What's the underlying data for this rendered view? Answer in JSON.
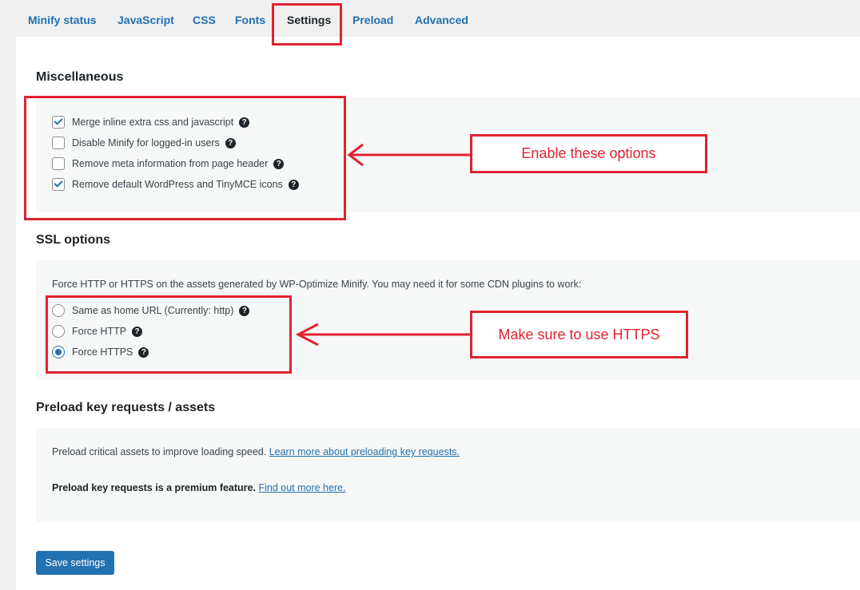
{
  "tabs": [
    {
      "label": "Minify status"
    },
    {
      "label": "JavaScript"
    },
    {
      "label": "CSS"
    },
    {
      "label": "Fonts"
    },
    {
      "label": "Settings"
    },
    {
      "label": "Preload"
    },
    {
      "label": "Advanced"
    }
  ],
  "active_tab": "Settings",
  "miscellaneous": {
    "title": "Miscellaneous",
    "options": [
      {
        "label": "Merge inline extra css and javascript",
        "checked": true
      },
      {
        "label": "Disable Minify for logged-in users",
        "checked": false
      },
      {
        "label": "Remove meta information from page header",
        "checked": false
      },
      {
        "label": "Remove default WordPress and TinyMCE icons",
        "checked": true
      }
    ]
  },
  "ssl": {
    "title": "SSL options",
    "description": "Force HTTP or HTTPS on the assets generated by WP-Optimize Minify. You may need it for some CDN plugins to work:",
    "options": [
      {
        "label": "Same as home URL (Currently: http)",
        "selected": false
      },
      {
        "label": "Force HTTP",
        "selected": false
      },
      {
        "label": "Force HTTPS",
        "selected": true
      }
    ]
  },
  "preload": {
    "title": "Preload key requests / assets",
    "description": "Preload critical assets to improve loading speed.",
    "learn_link": "Learn more about preloading key requests.",
    "premium_text": "Preload key requests is a premium feature.",
    "premium_link": "Find out more here."
  },
  "annotations": {
    "callout_1": "Enable these options",
    "callout_2": "Make sure to use HTTPS",
    "color": "#e02330"
  },
  "save_button": "Save settings",
  "help_icon": "?",
  "colors": {
    "accent": "#2271b1",
    "annotation": "#e02330"
  }
}
